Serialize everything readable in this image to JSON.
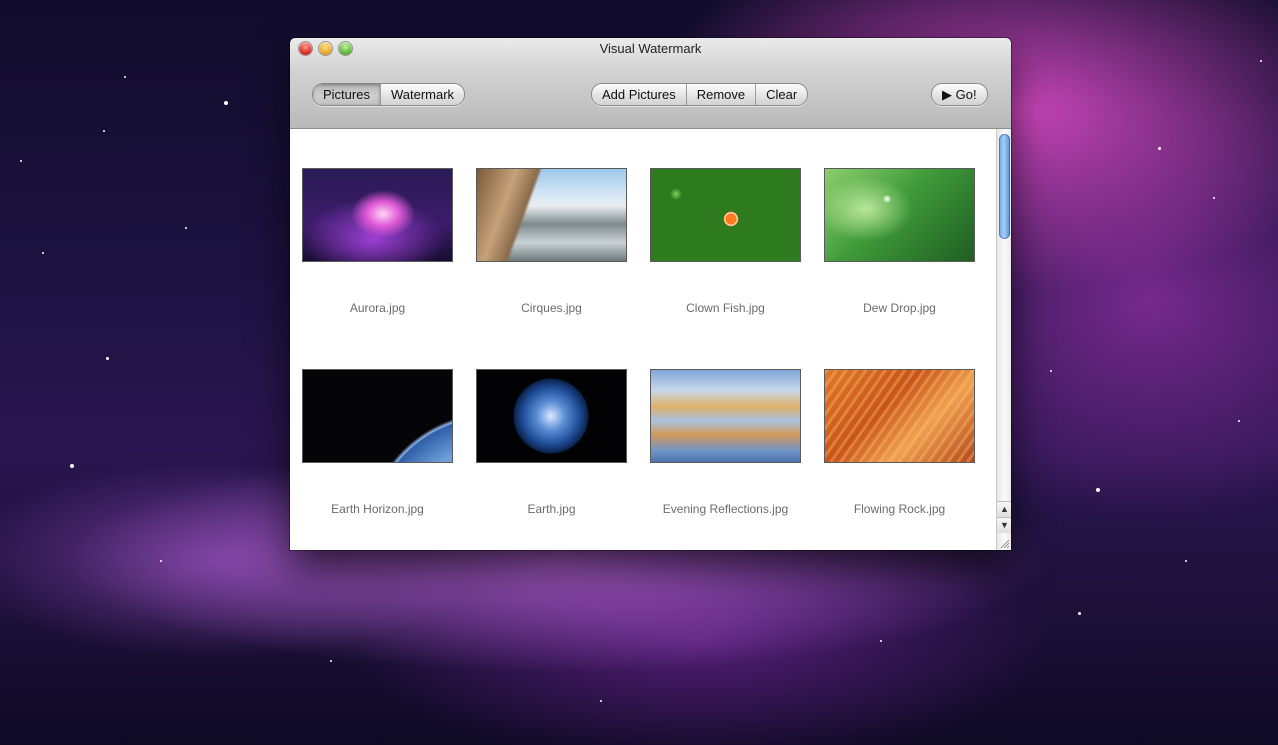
{
  "window": {
    "title": "Visual Watermark"
  },
  "toolbar": {
    "view_segment": [
      {
        "label": "Pictures",
        "active": true
      },
      {
        "label": "Watermark",
        "active": false
      }
    ],
    "actions": [
      {
        "label": "Add Pictures"
      },
      {
        "label": "Remove"
      },
      {
        "label": "Clear"
      }
    ],
    "go_label": "▶ Go!"
  },
  "pictures": [
    {
      "name": "Aurora.jpg",
      "icon": "aurora-thumbnail"
    },
    {
      "name": "Cirques.jpg",
      "icon": "cirques-thumbnail"
    },
    {
      "name": "Clown Fish.jpg",
      "icon": "clown-fish-thumbnail"
    },
    {
      "name": "Dew Drop.jpg",
      "icon": "dew-drop-thumbnail"
    },
    {
      "name": "Earth Horizon.jpg",
      "icon": "earth-horizon-thumbnail"
    },
    {
      "name": "Earth.jpg",
      "icon": "earth-thumbnail"
    },
    {
      "name": "Evening Reflections.jpg",
      "icon": "evening-reflections-thumbnail"
    },
    {
      "name": "Flowing Rock.jpg",
      "icon": "flowing-rock-thumbnail"
    }
  ],
  "scrollbar": {
    "up_arrow": "▲",
    "down_arrow": "▼"
  },
  "colors": {
    "accent_scroll": "#6aa3e6",
    "caption_text": "#6b6b6b"
  }
}
